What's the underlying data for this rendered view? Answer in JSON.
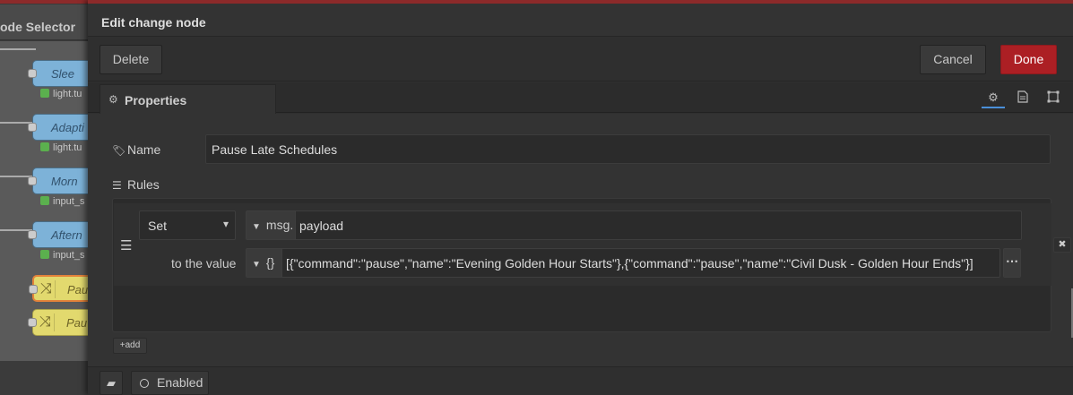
{
  "canvas": {
    "tab_title": "ode Selector",
    "nodes": [
      {
        "label": "Slee",
        "status": "light.tu"
      },
      {
        "label": "Adapti",
        "status": "light.tu"
      },
      {
        "label": "Morn",
        "status": "input_s"
      },
      {
        "label": "Aftern",
        "status": "input_s"
      },
      {
        "label": "Pau"
      },
      {
        "label": "Pau"
      }
    ]
  },
  "tray": {
    "title": "Edit change node",
    "delete_label": "Delete",
    "cancel_label": "Cancel",
    "done_label": "Done",
    "properties_tab": "Properties",
    "side_tabs": [
      "gear-icon",
      "description-icon",
      "appearance-icon"
    ]
  },
  "form": {
    "name_label": "Name",
    "name_value": "Pause Late Schedules",
    "rules_label": "Rules",
    "rule": {
      "action": "Set",
      "target_type": "msg.",
      "target_value": "payload",
      "to_label": "to the value",
      "value_type": "{}",
      "value": "[{\"command\":\"pause\",\"name\":\"Evening Golden Hour Starts\"},{\"command\":\"pause\",\"name\":\"Civil Dusk - Golden Hour Ends\"}]"
    },
    "add_label": "add"
  },
  "footer": {
    "enabled_label": "Enabled"
  },
  "colors": {
    "done": "#ac1f24",
    "flow_node_blue": "#7db2d8",
    "change_node_yellow": "#e2d96e",
    "status_green": "#5bb04e"
  }
}
